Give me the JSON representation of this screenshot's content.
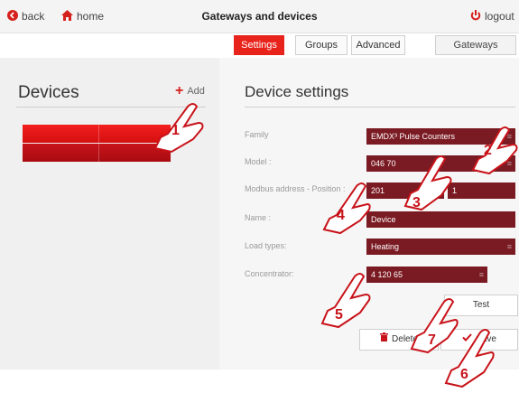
{
  "header": {
    "back_label": "back",
    "home_label": "home",
    "title": "Gateways and devices",
    "logout_label": "logout"
  },
  "tabs": {
    "settings": "Settings",
    "groups": "Groups",
    "advanced": "Advanced",
    "gateways": "Gateways"
  },
  "left": {
    "title": "Devices",
    "add_label": "Add"
  },
  "settings": {
    "title": "Device settings",
    "family_label": "Family",
    "family_value": "EMDX³ Pulse Counters",
    "model_label": "Model :",
    "model_value": "046 70",
    "modbus_label": "Modbus address - Position :",
    "modbus_value": "201",
    "position_value": "1",
    "name_label": "Name :",
    "name_value": "Device",
    "load_label": "Load types:",
    "load_value": "Heating",
    "concentrator_label": "Concentrator:",
    "concentrator_value": "4 120 65"
  },
  "buttons": {
    "test": "Test",
    "delete": "Delete",
    "save": "Save"
  },
  "callouts": {
    "c1": "1",
    "c2": "2",
    "c3": "3",
    "c4": "4",
    "c5": "5",
    "c6": "6",
    "c7": "7"
  },
  "colors": {
    "accent_red": "#e8231b",
    "field_bg": "#7a1a22"
  }
}
